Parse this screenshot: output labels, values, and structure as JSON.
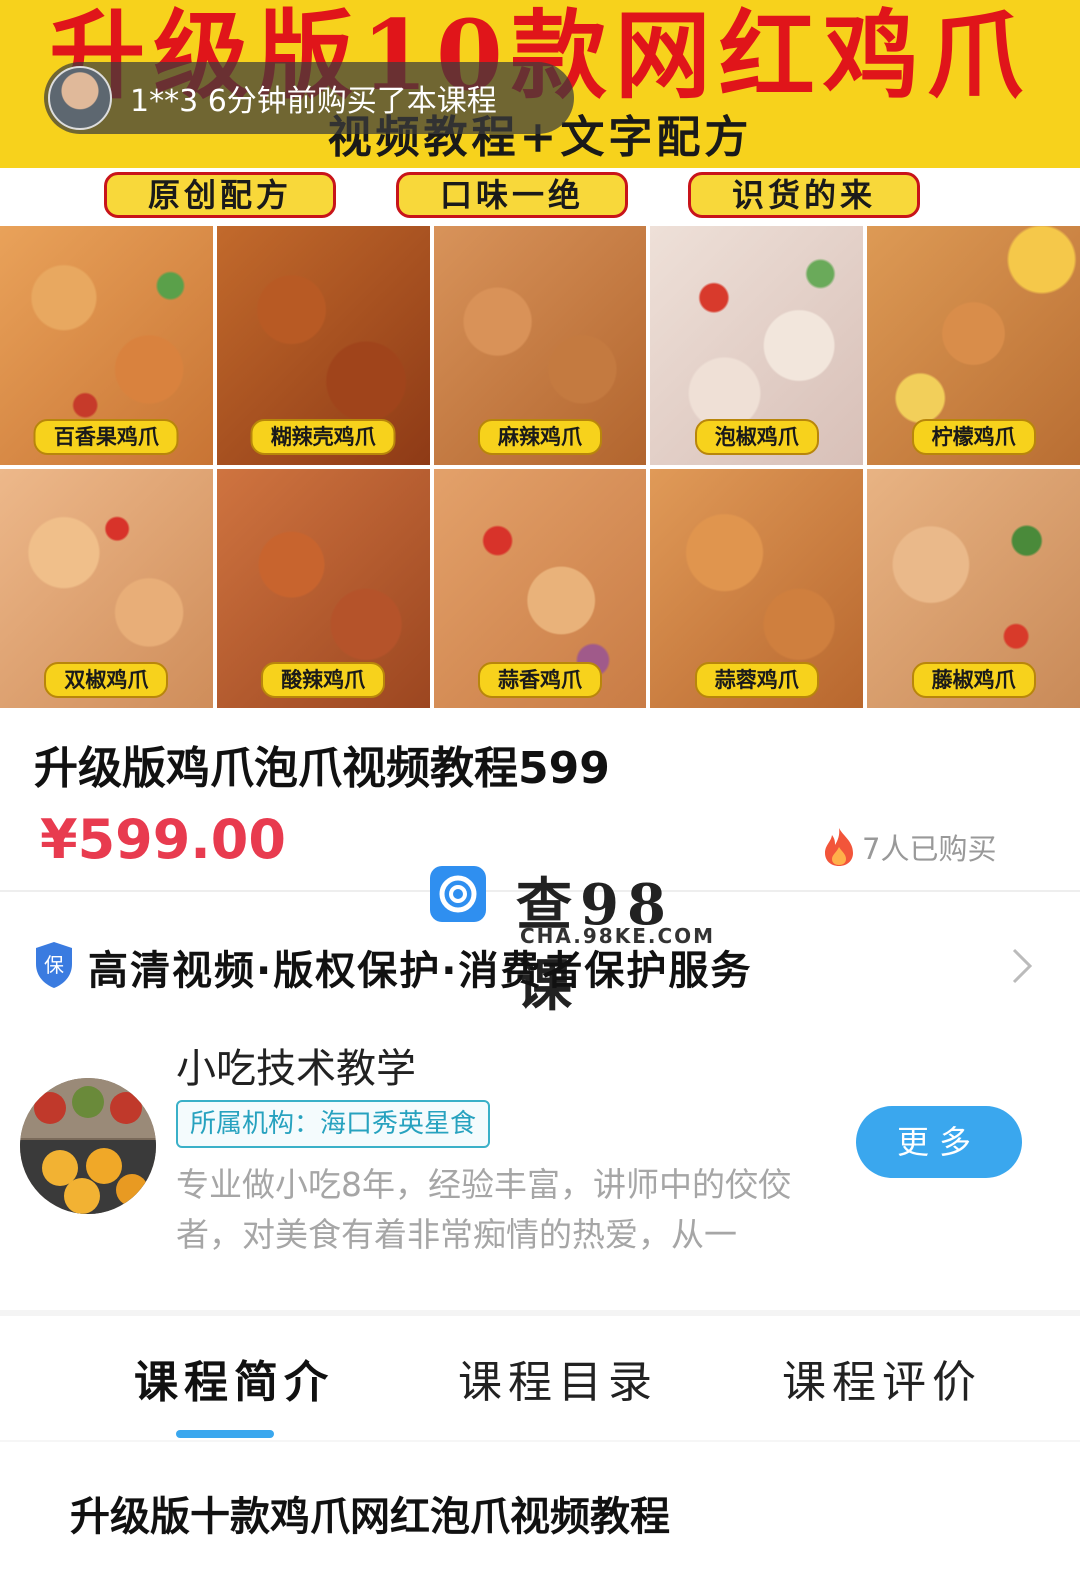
{
  "banner": {
    "title": "升级版10款网红鸡爪",
    "subtitle": "视频教程+文字配方",
    "pills": [
      "原创配方",
      "口味一绝",
      "识货的来"
    ],
    "dishes": [
      "百香果鸡爪",
      "糊辣壳鸡爪",
      "麻辣鸡爪",
      "泡椒鸡爪",
      "柠檬鸡爪",
      "双椒鸡爪",
      "酸辣鸡爪",
      "蒜香鸡爪",
      "蒜蓉鸡爪",
      "藤椒鸡爪"
    ]
  },
  "toast": {
    "text": "1**3 6分钟前购买了本课程"
  },
  "course": {
    "title": "升级版鸡爪泡爪视频教程599",
    "price": "¥599.00",
    "sold": "7人已购买"
  },
  "watermark": {
    "name": "查98课",
    "url": "CHA.98KE.COM"
  },
  "service": {
    "text": "高清视频·版权保护·消费者保护服务"
  },
  "teacher": {
    "name": "小吃技术教学",
    "org": "所属机构：海口秀英星食",
    "desc": "专业做小吃8年，经验丰富，讲师中的佼佼者，对美食有着非常痴情的热爱，从一",
    "more": "更多"
  },
  "tabs": [
    "课程简介",
    "课程目录",
    "课程评价"
  ],
  "intro": {
    "heading": "升级版十款鸡爪网红泡爪视频教程"
  },
  "colors": {
    "price": "#e83b4f",
    "accent": "#3aa7ee",
    "banner_yellow": "#f7d21c",
    "banner_red": "#e0151a"
  }
}
